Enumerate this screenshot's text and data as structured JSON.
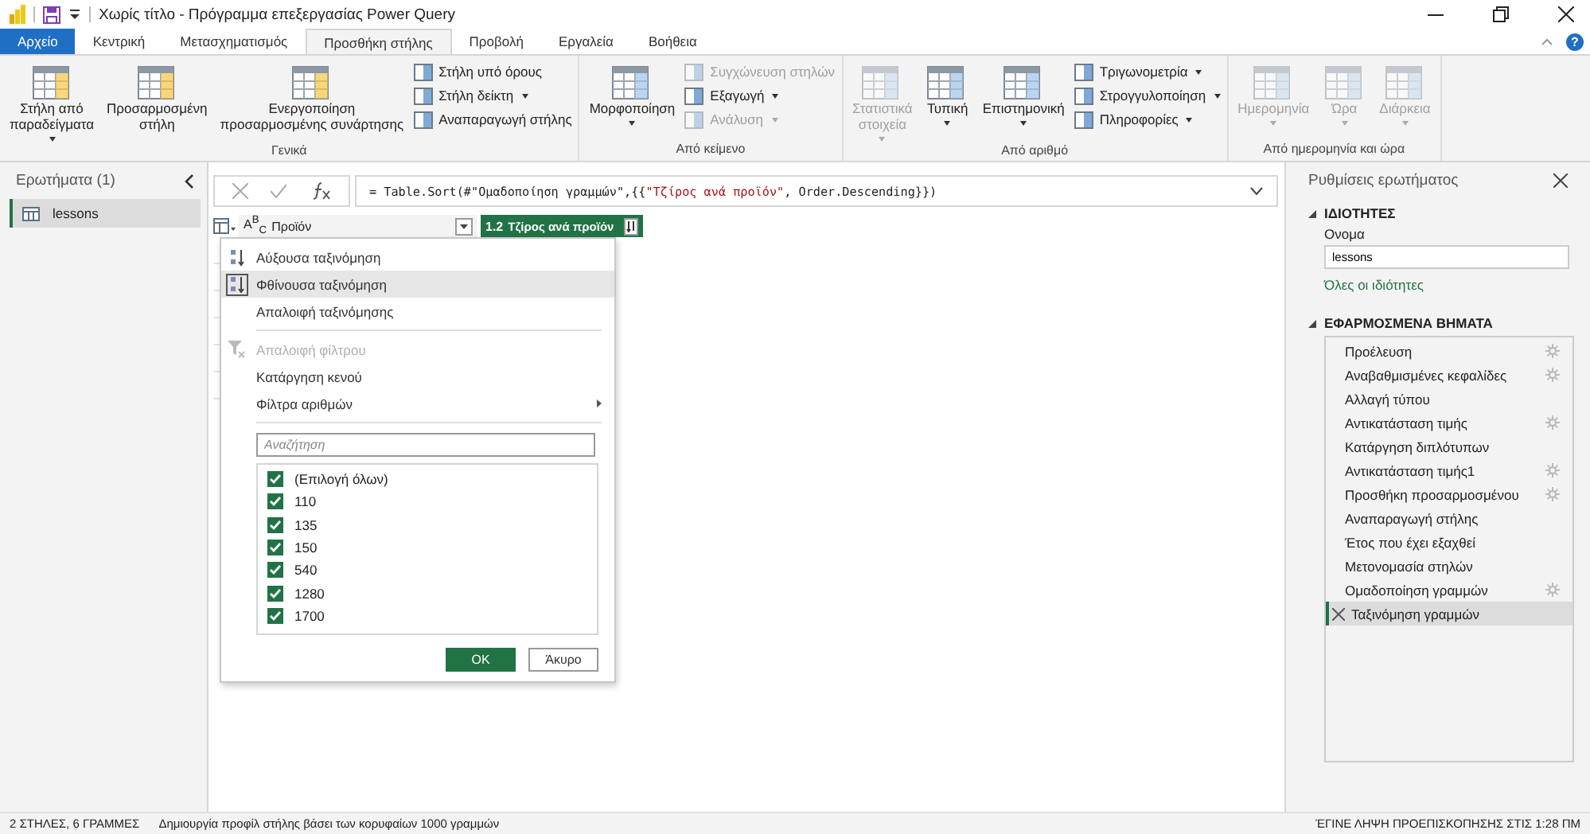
{
  "window": {
    "title": "Χωρίς τίτλο - Πρόγραμμα επεξεργασίας Power Query",
    "help": "?"
  },
  "menu_tabs": [
    {
      "label": "Αρχείο",
      "kind": "file",
      "selected": false
    },
    {
      "label": "Κεντρική",
      "kind": "tab",
      "selected": false
    },
    {
      "label": "Μετασχηματισμός",
      "kind": "tab",
      "selected": false
    },
    {
      "label": "Προσθήκη στήλης",
      "kind": "tab",
      "selected": true
    },
    {
      "label": "Προβολή",
      "kind": "tab",
      "selected": false
    },
    {
      "label": "Εργαλεία",
      "kind": "tab",
      "selected": false
    },
    {
      "label": "Βοήθεια",
      "kind": "tab",
      "selected": false
    }
  ],
  "ribbon": {
    "groups": [
      {
        "label": "Γενικά",
        "columns": [
          {
            "kind": "large",
            "label": "Στήλη από\nπαραδείγματα",
            "dropdown": true,
            "disabled": false
          },
          {
            "kind": "large",
            "label": "Προσαρμοσμένη\nστήλη",
            "dropdown": false,
            "disabled": false
          },
          {
            "kind": "large",
            "label": "Ενεργοποίηση\nπροσαρμοσμένης συνάρτησης",
            "dropdown": false,
            "disabled": false
          },
          {
            "kind": "stack",
            "items": [
              {
                "label": "Στήλη υπό όρους",
                "dropdown": false,
                "disabled": false
              },
              {
                "label": "Στήλη δείκτη",
                "dropdown": true,
                "disabled": false
              },
              {
                "label": "Αναπαραγωγή στήλης",
                "dropdown": false,
                "disabled": false
              }
            ]
          }
        ]
      },
      {
        "label": "Από κείμενο",
        "columns": [
          {
            "kind": "large",
            "label": "Μορφοποίηση",
            "dropdown": true,
            "disabled": false
          },
          {
            "kind": "stack",
            "items": [
              {
                "label": "Συγχώνευση στηλών",
                "dropdown": false,
                "disabled": true
              },
              {
                "label": "Εξαγωγή",
                "dropdown": true,
                "disabled": false
              },
              {
                "label": "Ανάλυση",
                "dropdown": true,
                "disabled": true
              }
            ]
          }
        ]
      },
      {
        "label": "Από αριθμό",
        "columns": [
          {
            "kind": "large",
            "label": "Στατιστικά\nστοιχεία",
            "dropdown": true,
            "disabled": true
          },
          {
            "kind": "large",
            "label": "Τυπική",
            "dropdown": true,
            "disabled": false
          },
          {
            "kind": "large",
            "label": "Επιστημονική",
            "dropdown": true,
            "disabled": false
          },
          {
            "kind": "stack",
            "items": [
              {
                "label": "Τριγωνομετρία",
                "dropdown": true,
                "disabled": false
              },
              {
                "label": "Στρογγυλοποίηση",
                "dropdown": true,
                "disabled": false
              },
              {
                "label": "Πληροφορίες",
                "dropdown": true,
                "disabled": false
              }
            ]
          }
        ]
      },
      {
        "label": "Από ημερομηνία και ώρα",
        "columns": [
          {
            "kind": "large",
            "label": "Ημερομηνία",
            "dropdown": true,
            "disabled": true
          },
          {
            "kind": "large",
            "label": "Ώρα",
            "dropdown": true,
            "disabled": true
          },
          {
            "kind": "large",
            "label": "Διάρκεια",
            "dropdown": true,
            "disabled": true
          }
        ]
      }
    ]
  },
  "queries_pane": {
    "title": "Ερωτήματα (1)",
    "items": [
      {
        "label": "lessons",
        "selected": true
      }
    ]
  },
  "formula_bar": {
    "parts": [
      {
        "text": "= Table.Sort(#\"Ομαδοποίηση γραμμών\",{{",
        "kind": "code"
      },
      {
        "text": "\"Τζίρος ανά προϊόν\"",
        "kind": "string"
      },
      {
        "text": ", Order.Descending}})",
        "kind": "code"
      }
    ]
  },
  "table": {
    "columns": [
      {
        "type": "A$^{B}$$_{C}$",
        "name": "Προϊόν",
        "selected": false
      },
      {
        "type": "1.2",
        "name": "Τζίρος ανά προϊόν",
        "selected": true
      }
    ]
  },
  "filter_menu": {
    "items": [
      {
        "kind": "sort-asc",
        "label": "Αύξουσα ταξινόμηση",
        "selected": false,
        "disabled": false
      },
      {
        "kind": "sort-desc",
        "label": "Φθίνουσα ταξινόμηση",
        "selected": true,
        "disabled": false
      },
      {
        "kind": "item",
        "label": "Απαλοιφή ταξινόμησης",
        "selected": false,
        "disabled": false
      },
      {
        "kind": "clear-filter",
        "label": "Απαλοιφή φίλτρου",
        "selected": false,
        "disabled": true
      },
      {
        "kind": "item",
        "label": "Κατάργηση κενού",
        "selected": false,
        "disabled": false
      },
      {
        "kind": "submenu",
        "label": "Φίλτρα αριθμών",
        "selected": false,
        "disabled": false
      }
    ],
    "search": {
      "placeholder": "Αναζήτηση"
    },
    "values": [
      {
        "label": "(Επιλογή όλων)",
        "checked": true
      },
      {
        "label": "110",
        "checked": true
      },
      {
        "label": "135",
        "checked": true
      },
      {
        "label": "150",
        "checked": true
      },
      {
        "label": "540",
        "checked": true
      },
      {
        "label": "1280",
        "checked": true
      },
      {
        "label": "1700",
        "checked": true
      }
    ],
    "buttons": [
      {
        "label": "OK",
        "kind": "primary"
      },
      {
        "label": "Άκυρο",
        "kind": "secondary"
      }
    ]
  },
  "settings_pane": {
    "title": "Ρυθμίσεις ερωτήματος",
    "properties_heading": "ΙΔΙΟΤΗΤΕΣ",
    "name_label": "Ονομα",
    "name_value": "lessons",
    "all_properties_link": "Όλες οι ιδιότητες",
    "steps_heading": "ΕΦΑΡΜΟΣΜΕΝΑ ΒΗΜΑΤΑ",
    "steps": [
      {
        "label": "Προέλευση",
        "settings": true,
        "selected": false
      },
      {
        "label": "Αναβαθμισμένες κεφαλίδες",
        "settings": true,
        "selected": false
      },
      {
        "label": "Αλλαγή τύπου",
        "settings": false,
        "selected": false
      },
      {
        "label": "Αντικατάσταση τιμής",
        "settings": true,
        "selected": false
      },
      {
        "label": "Κατάργηση διπλότυπων",
        "settings": false,
        "selected": false
      },
      {
        "label": "Αντικατάσταση τιμής1",
        "settings": true,
        "selected": false
      },
      {
        "label": "Προσθήκη προσαρμοσμένου",
        "settings": true,
        "selected": false
      },
      {
        "label": "Αναπαραγωγή στήλης",
        "settings": false,
        "selected": false
      },
      {
        "label": "Έτος που έχει εξαχθεί",
        "settings": false,
        "selected": false
      },
      {
        "label": "Μετονομασία στηλών",
        "settings": false,
        "selected": false
      },
      {
        "label": "Ομαδοποίηση γραμμών",
        "settings": true,
        "selected": false
      },
      {
        "label": "Ταξινόμηση γραμμών",
        "settings": false,
        "selected": true
      }
    ]
  },
  "status_bar": {
    "columns_rows": "2 ΣΤΗΛΕΣ, 6 ΓΡΑΜΜΕΣ",
    "profiling": "Δημιουργία προφίλ στήλης βάσει των κορυφαίων 1000 γραμμών",
    "preview": "ΈΓΙΝΕ ΛΗΨΗ ΠΡΟΕΠΙΣΚΟΠΗΣΗΣ ΣΤΙΣ 1:28 ΠΜ"
  }
}
